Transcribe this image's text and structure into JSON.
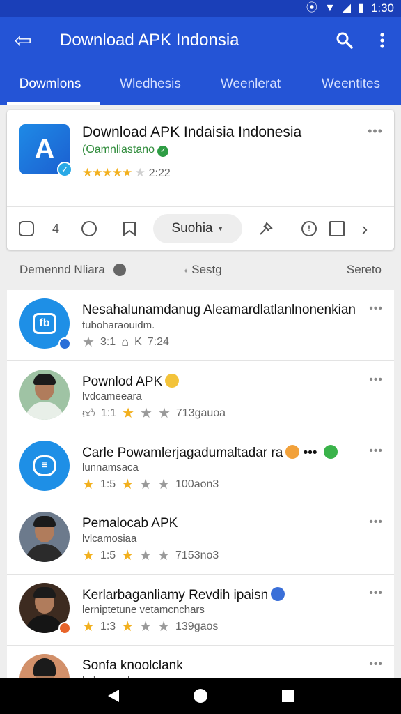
{
  "status_bar": {
    "time": "1:30",
    "icons": [
      "vibrate-icon",
      "wifi-icon",
      "signal-icon",
      "battery-icon"
    ]
  },
  "app_bar": {
    "title": "Download APK Indonsia",
    "back_icon": "arrow-left-icon",
    "search_icon": "search-icon",
    "menu_icon": "more-vert-icon"
  },
  "tabs": [
    {
      "label": "Dowmlons",
      "active": true
    },
    {
      "label": "Wledhesis",
      "active": false
    },
    {
      "label": "Weenlerat",
      "active": false
    },
    {
      "label": "Weentites",
      "active": false
    }
  ],
  "app_card": {
    "title": "Download APK Indaisia Indonesia",
    "developer": "(Oamnliastano",
    "rating_text": "2:22",
    "icon_letter": "A",
    "more": "•••",
    "actions": {
      "count": "4",
      "pill_label": "Suohia"
    }
  },
  "section": {
    "left": "Demennd Nliara",
    "middle": "Sestg",
    "right": "Sereto"
  },
  "list": [
    {
      "name": "Nesahalunamdanug Aleamardlatlanlnonenkian",
      "sub": "tuboharaouidm.",
      "meta1": "3:1",
      "meta2": "K",
      "meta3": "7:24",
      "avatar": "blue"
    },
    {
      "name": "Pownlod APK",
      "sub": "lvdcameeara",
      "meta1": "1:1",
      "meta3": "713gauoa",
      "avatar": "person"
    },
    {
      "name": "Carle Powamlerjagadumaltadar ra",
      "sub": "lunnamsaca",
      "meta1": "1:5",
      "meta3": "100aon3",
      "avatar": "blue"
    },
    {
      "name": "Pemalocab APK",
      "sub": "lvlcamosiaa",
      "meta1": "1:5",
      "meta3": "7153no3",
      "avatar": "person"
    },
    {
      "name": "Kerlarbaganliamy Revdih ipaisn",
      "sub": "lerniptetune vetamcnchars",
      "meta1": "1:3",
      "meta3": "139gaos",
      "avatar": "person"
    },
    {
      "name": "Sonfa knoolclank",
      "sub": "lvdaamoalea",
      "avatar": "person"
    }
  ],
  "nav": {
    "back": "back-icon",
    "home": "home-icon",
    "recents": "recents-icon"
  }
}
